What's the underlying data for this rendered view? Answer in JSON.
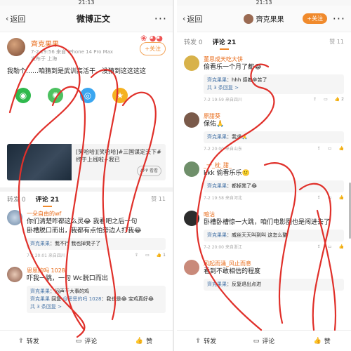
{
  "status": {
    "time": "21:13"
  },
  "left": {
    "nav": {
      "back": "返回",
      "title": "微博正文",
      "more": "···"
    },
    "post": {
      "author": "齊克果果",
      "meta": "7-2 19:56 来自 iPhone 14 Pro Max",
      "meta2": "发布于 上海",
      "follow": "+关注",
      "text": "我勒个……咱猜到是武训高活干，没猜到这这这这",
      "share_icons": [
        "wechat-icon",
        "moments-icon",
        "qq-icon",
        "qzone-icon"
      ]
    },
    "card": {
      "title": "[笑哈哈][笑哈哈]#三国谋定天下#终于上线啦~我已",
      "app": "APP 看看"
    },
    "tabs": {
      "repost": "转发 0",
      "comment": "评论 21",
      "like": "赞 11"
    },
    "comments": [
      {
        "name": "一朵自由的wf",
        "text": "你们清楚咋都这么灵😂 我看吧之后一句",
        "text2": "卧槽脱口而出，我都有点怕旁边人打我😂",
        "reply_name": "齊克果果",
        "reply_text": "：我不行 我也掉凳子了",
        "time": "7-2 20:01 来自四川",
        "like": "1"
      },
      {
        "name": "思思的吗 1028",
        "text": "吓我一跳，一句 Wc脱口而出",
        "reply_name": "齊克果果",
        "reply_text": "：闷声干大事的鸡",
        "reply2_name": "齊克果果",
        "reply2_mid": "回复",
        "reply2_at": "@思思的吗 1028",
        "reply2_text": "：我也是😂 宝鸡真好😂",
        "more": "共 3 条回复 >",
        "time": "",
        "like": ""
      }
    ],
    "bottom": {
      "repost": "转发",
      "comment": "评论",
      "like": "赞"
    }
  },
  "right": {
    "nav": {
      "back": "返回",
      "title": "齊克果果",
      "follow": "+关注",
      "more": "···"
    },
    "tabs": {
      "repost": "转发 0",
      "comment": "评论 21",
      "like": "赞 11"
    },
    "comments": [
      {
        "name": "董思成天吃大饼",
        "text": "偷看乐一个月了都😂",
        "reply_name": "齊克果果",
        "reply_text": "：hhh 感着辛苦了",
        "more": "共 3 条回复 >",
        "time": "7-2 19:59 来自四川",
        "like": "2"
      },
      {
        "name": "原甜葵",
        "text": "保佑🙏",
        "reply_name": "齊克果果",
        "reply_text": "：我求🙏",
        "more": "",
        "time": "7-2 20:00 来自山东",
        "like": ""
      },
      {
        "name": "_一_枕_甜_",
        "text": "kkk 偷看乐乐🙂",
        "reply_name": "齊克果果",
        "reply_text": "：都掉凳了😂",
        "more": "",
        "time": "7-2 19:58 来自河北",
        "like": ""
      },
      {
        "name": "暗沽",
        "text": "卧槽卧槽惊一大跳，咱们电影圈也是闯进去了",
        "reply_name": "齊克果果",
        "reply_text": "：威丝天天叫到叫 这怎么整",
        "more": "",
        "time": "7-2 20:00 来自浙江",
        "like": ""
      },
      {
        "name": "风起而涌_风止而息",
        "text": "看到不敢相信的程度",
        "reply_name": "齊克果果",
        "reply_text": "：反复退出点进",
        "more": "",
        "time": "",
        "like": ""
      }
    ],
    "bottom": {
      "repost": "转发",
      "comment": "评论",
      "like": "赞"
    }
  },
  "colors": {
    "accent": "#f08a2c",
    "name": "#e86a17",
    "link": "#4a76a8",
    "scribble": "#e0302a"
  }
}
